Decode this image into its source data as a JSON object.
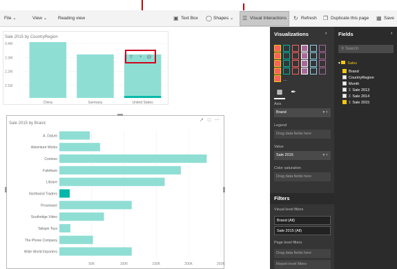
{
  "annotations": {
    "arrow_color": "#c00000"
  },
  "toolbar": {
    "file": "File",
    "view": "View",
    "reading_view": "Reading view",
    "text_box": "Text Box",
    "shapes": "Shapes",
    "visual_interactions": "Visual Interactions",
    "refresh": "Refresh",
    "duplicate_page": "Duplicate this page",
    "save": "Save"
  },
  "column_visual": {
    "title": "Sale 2015 by CountryRegion",
    "focus_icons": [
      "filter-icon",
      "highlight-icon",
      "none-icon"
    ],
    "highlight_color": "#d0021b"
  },
  "bar_visual": {
    "title": "Sale 2015 by Brand",
    "header_icons": "↗ □ ⋯"
  },
  "chart_data": [
    {
      "type": "bar",
      "title": "Sale 2015 by CountryRegion",
      "categories": [
        "China",
        "Germany",
        "United States"
      ],
      "values": [
        3.4,
        2.65,
        2.65
      ],
      "highlight_values": [
        0,
        0,
        0.12
      ],
      "y_tick_labels": [
        "0.4M",
        "2.3M",
        "2.2M",
        "2.1M"
      ],
      "ylim": [
        0,
        3.4
      ],
      "color": "#8fded4",
      "highlight_color": "#01b8aa"
    },
    {
      "type": "bar",
      "orientation": "horizontal",
      "title": "Sale 2015 by Brand",
      "categories": [
        "A. Datum",
        "Adventure Works",
        "Contoso",
        "Fabrikam",
        "Litware",
        "Northwind Traders",
        "Proseware",
        "Southridge Video",
        "Tailspin Toys",
        "The Phone Company",
        "Wide World Importers"
      ],
      "values": [
        47000,
        63000,
        228000,
        188000,
        163000,
        16000,
        112000,
        69000,
        17000,
        52000,
        112000
      ],
      "highlight_values": [
        0,
        0,
        0,
        0,
        0,
        16000,
        0,
        0,
        0,
        0,
        0
      ],
      "x_tick_labels": [
        "50K",
        "100K",
        "150K",
        "200K",
        "250K"
      ],
      "x_tick_values": [
        50000,
        100000,
        150000,
        200000,
        250000
      ],
      "xlim": [
        0,
        250000
      ],
      "color": "#8fded4",
      "highlight_color": "#01b8aa"
    }
  ],
  "visualizations": {
    "title": "Visualizations",
    "more": "...",
    "wells": [
      {
        "label": "Axis",
        "value": "Brand",
        "filled": true
      },
      {
        "label": "Legend",
        "value": "Drag data fields here",
        "filled": false
      },
      {
        "label": "Value",
        "value": "Sale 2015",
        "filled": true
      },
      {
        "label": "Color saturation",
        "value": "Drag data fields here",
        "filled": false
      }
    ],
    "filters_title": "Filters",
    "visual_level_filters": "Visual level filters",
    "filter_items": [
      "Brand (All)",
      "Sale 2015 (All)"
    ],
    "page_level_filters": "Page level filters",
    "page_drag": "Drag data fields here",
    "report_level_filters": "Report level filters"
  },
  "fields": {
    "title": "Fields",
    "search_placeholder": "Search",
    "table_name": "Sales",
    "items": [
      {
        "name": "Brand",
        "checked": true,
        "sigma": false
      },
      {
        "name": "CountryRegion",
        "checked": false,
        "sigma": false
      },
      {
        "name": "Month",
        "checked": false,
        "sigma": false
      },
      {
        "name": "Sale 2013",
        "checked": false,
        "sigma": true
      },
      {
        "name": "Sale 2014",
        "checked": false,
        "sigma": true
      },
      {
        "name": "Sale 2015",
        "checked": true,
        "sigma": true
      }
    ]
  }
}
